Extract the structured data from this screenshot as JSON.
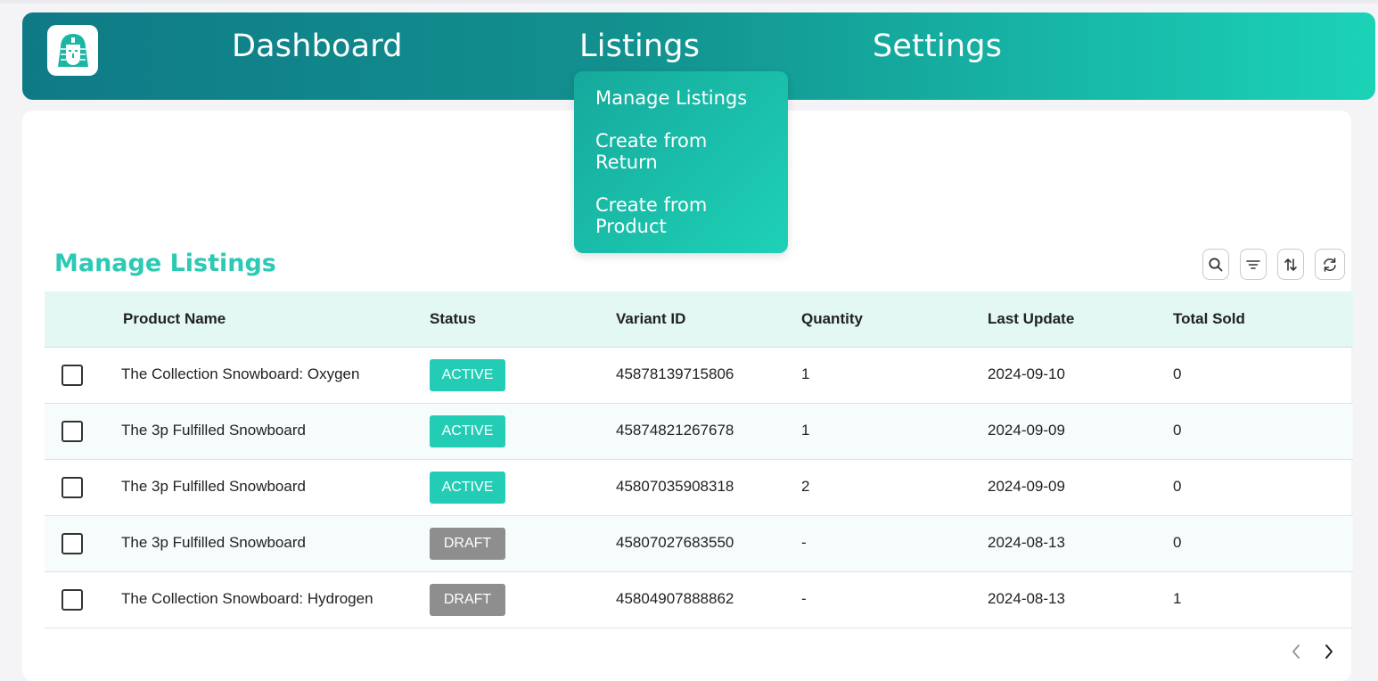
{
  "nav": {
    "items": [
      "Dashboard",
      "Listings",
      "Settings"
    ]
  },
  "dropdown": {
    "items": [
      "Manage Listings",
      "Create from Return",
      "Create from Product"
    ]
  },
  "page": {
    "title": "Manage Listings"
  },
  "toolbar": {
    "icons": [
      "search-icon",
      "filter-icon",
      "sort-icon",
      "refresh-icon"
    ]
  },
  "table": {
    "headers": [
      "Product Name",
      "Status",
      "Variant ID",
      "Quantity",
      "Last Update",
      "Total Sold"
    ],
    "rows": [
      [
        "The Collection Snowboard: Oxygen",
        "ACTIVE",
        "45878139715806",
        "1",
        "2024-09-10",
        "0"
      ],
      [
        "The 3p Fulfilled Snowboard",
        "ACTIVE",
        "45874821267678",
        "1",
        "2024-09-09",
        "0"
      ],
      [
        "The 3p Fulfilled Snowboard",
        "ACTIVE",
        "45807035908318",
        "2",
        "2024-09-09",
        "0"
      ],
      [
        "The 3p Fulfilled Snowboard",
        "DRAFT",
        "45807027683550",
        "-",
        "2024-08-13",
        "0"
      ],
      [
        "The Collection Snowboard: Hydrogen",
        "DRAFT",
        "45804907888862",
        "-",
        "2024-08-13",
        "1"
      ]
    ]
  },
  "colors": {
    "accent": "#2cc9b4",
    "active_badge": "#23cdb5",
    "draft_badge": "#8e8e8e",
    "header_bg": "#e3f7f3"
  }
}
